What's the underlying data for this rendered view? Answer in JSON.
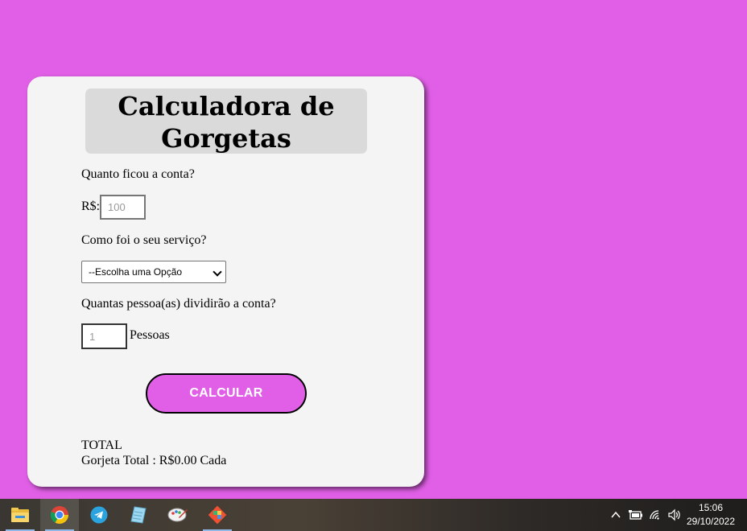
{
  "app": {
    "title_line1": "Calculadora de",
    "title_line2": "Gorgetas"
  },
  "form": {
    "bill_question": "Quanto ficou a conta?",
    "currency_prefix": "R$:",
    "bill_placeholder": "100",
    "service_question": "Como foi o seu serviço?",
    "service_selected": "--Escolha uma Opção",
    "people_question": "Quantas pessoa(as) dividirão a conta?",
    "people_placeholder": "1",
    "people_suffix": "Pessoas",
    "calculate_label": "CALCULAR"
  },
  "result": {
    "total_label": "TOTAL",
    "tip_line": "Gorjeta Total : R$0.00 Cada"
  },
  "taskbar": {
    "apps": [
      {
        "name": "file-explorer-icon"
      },
      {
        "name": "chrome-icon"
      },
      {
        "name": "telegram-icon"
      },
      {
        "name": "notepad-icon"
      },
      {
        "name": "paint-icon"
      },
      {
        "name": "git-icon"
      }
    ],
    "time": "15:06",
    "date": "29/10/2022"
  },
  "colors": {
    "background": "#e05fe6",
    "card": "#f4f4f4",
    "title_box": "#dadada",
    "button": "#e05fe6"
  }
}
